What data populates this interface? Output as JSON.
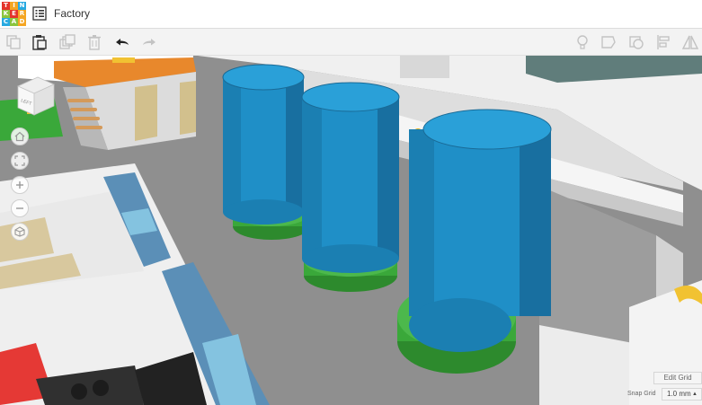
{
  "app": {
    "logo_letters": [
      "T",
      "I",
      "N",
      "K",
      "E",
      "R",
      "C",
      "A",
      "D"
    ],
    "logo_colors": [
      "#e4332b",
      "#f5a623",
      "#27a9e1",
      "#8bc53f",
      "#e4332b",
      "#f5a623",
      "#27a9e1",
      "#8bc53f",
      "#f5a623"
    ],
    "title": "Factory"
  },
  "toolbar": {
    "left_icons": [
      "copy-icon",
      "paste-icon",
      "duplicate-icon",
      "delete-icon",
      "undo-icon",
      "redo-icon"
    ],
    "right_icons": [
      "light-bulb-icon",
      "note-icon",
      "shape-icon",
      "align-icon",
      "mirror-icon"
    ]
  },
  "view_cube": {
    "face_label": "LEFT"
  },
  "nav_controls": [
    "home-view-icon",
    "fit-view-icon",
    "zoom-in-icon",
    "zoom-out-icon",
    "ortho-view-icon"
  ],
  "grid": {
    "edit_label": "Edit Grid",
    "snap_label": "Snap Grid",
    "snap_value": "1.0 mm"
  },
  "colors": {
    "cylinder_blue": "#1f8fc7",
    "base_green": "#3aa83a",
    "floor_gray": "#9a9a9a",
    "wall_white": "#f1f1f1",
    "roof_orange": "#e8882c",
    "accent_red": "#e53935"
  }
}
